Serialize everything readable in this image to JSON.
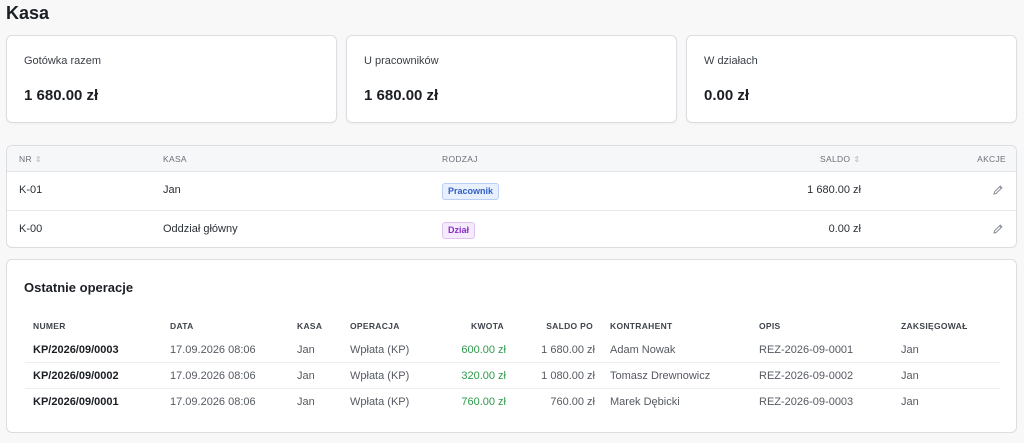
{
  "page": {
    "title": "Kasa"
  },
  "summary": [
    {
      "label": "Gotówka razem",
      "value": "1 680.00 zł"
    },
    {
      "label": "U pracowników",
      "value": "1 680.00 zł"
    },
    {
      "label": "W działach",
      "value": "0.00 zł"
    }
  ],
  "kasa_table": {
    "headers": {
      "nr": "NR",
      "kasa": "KASA",
      "rodzaj": "RODZAJ",
      "saldo": "SALDO",
      "akcje": "AKCJE"
    },
    "rows": [
      {
        "nr": "K-01",
        "kasa": "Jan",
        "rodzaj": "Pracownik",
        "saldo": "1 680.00 zł"
      },
      {
        "nr": "K-00",
        "kasa": "Oddział główny",
        "rodzaj": "Dział",
        "saldo": "0.00 zł"
      }
    ],
    "icons": {
      "sort": "sort-icon",
      "edit": "pencil-icon"
    }
  },
  "operations": {
    "title": "Ostatnie operacje",
    "headers": {
      "numer": "NUMER",
      "data": "DATA",
      "kasa": "KASA",
      "operacja": "OPERACJA",
      "kwota": "KWOTA",
      "saldo_po": "SALDO PO",
      "kontrahent": "KONTRAHENT",
      "opis": "OPIS",
      "zaksiegowal": "ZAKSIĘGOWAŁ"
    },
    "rows": [
      {
        "numer": "KP/2026/09/0003",
        "data": "17.09.2026 08:06",
        "kasa": "Jan",
        "operacja": "Wpłata (KP)",
        "kwota": "600.00 zł",
        "saldo_po": "1 680.00 zł",
        "kontrahent": "Adam Nowak",
        "opis": "REZ-2026-09-0001",
        "zaksiegowal": "Jan"
      },
      {
        "numer": "KP/2026/09/0002",
        "data": "17.09.2026 08:06",
        "kasa": "Jan",
        "operacja": "Wpłata (KP)",
        "kwota": "320.00 zł",
        "saldo_po": "1 080.00 zł",
        "kontrahent": "Tomasz Drewnowicz",
        "opis": "REZ-2026-09-0002",
        "zaksiegowal": "Jan"
      },
      {
        "numer": "KP/2026/09/0001",
        "data": "17.09.2026 08:06",
        "kasa": "Jan",
        "operacja": "Wpłata (KP)",
        "kwota": "760.00 zł",
        "saldo_po": "760.00 zł",
        "kontrahent": "Marek Dębicki",
        "opis": "REZ-2026-09-0003",
        "zaksiegowal": "Jan"
      }
    ]
  },
  "colors": {
    "accent_green": "#2e9a4c",
    "badge_blue": "#2f5fc4",
    "badge_purple": "#8a2fc9"
  }
}
